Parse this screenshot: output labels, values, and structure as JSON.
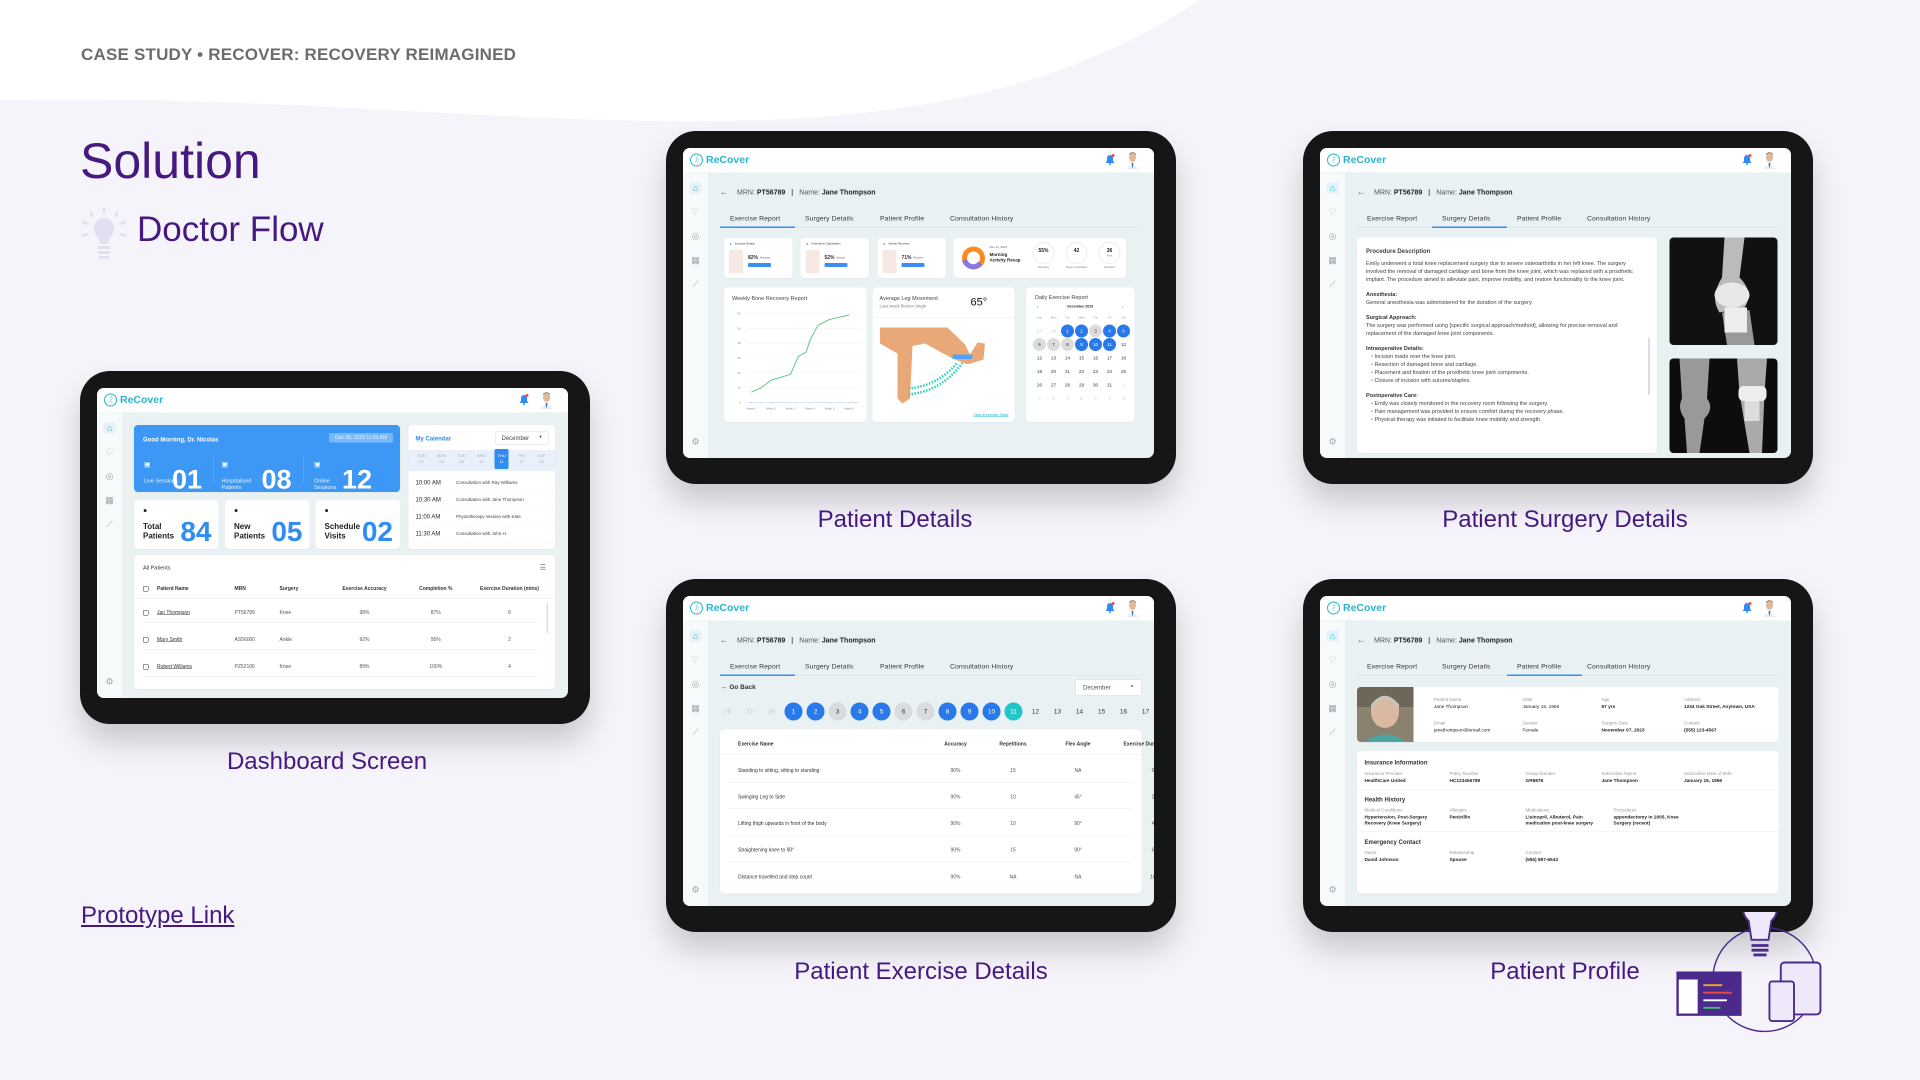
{
  "slide": {
    "eyebrow": "CASE STUDY • RECOVER: RECOVERY REIMAGINED",
    "title": "Solution",
    "subtitle": "Doctor Flow",
    "prototype_link": "Prototype Link",
    "title_color": "#45197f",
    "background": "#f5f4fa"
  },
  "captions": {
    "dashboard": "Dashboard Screen",
    "patient_details": "Patient Details",
    "surgery": "Patient Surgery Details",
    "exercise": "Patient Exercise Details",
    "profile": "Patient Profile"
  },
  "app": {
    "brand": "ReCover",
    "brand_color": "#2bb5c9",
    "primary": "#2f8cf0",
    "sidebar_icons": [
      "home-icon",
      "heart-icon",
      "target-icon",
      "calendar-icon",
      "chart-icon",
      "settings-icon"
    ]
  },
  "patient": {
    "mrn_label": "MRN:",
    "mrn": "PT56789",
    "name_label": "Name:",
    "name": "Jane Thompson",
    "tabs": [
      "Exercise Report",
      "Surgery Details",
      "Patient Profile",
      "Consultation History"
    ]
  },
  "dashboard": {
    "greeting": "Good Morning, Dr. Nicolas",
    "datetime": "Dec 08, 2023 11:00 AM",
    "sessions": [
      {
        "label": "Live Sessions",
        "value": "01"
      },
      {
        "label": "Hospitalised Patients",
        "value": "08"
      },
      {
        "label": "Online Sessions",
        "value": "12"
      }
    ],
    "cards": [
      {
        "label": "Total Patients",
        "value": "84"
      },
      {
        "label": "New Patients",
        "value": "05"
      },
      {
        "label": "Schedule Visits",
        "value": "02"
      }
    ],
    "calendar": {
      "title": "My Calendar",
      "month": "December",
      "days": [
        {
          "d": "SUN",
          "n": "07"
        },
        {
          "d": "MON",
          "n": "08"
        },
        {
          "d": "TUE",
          "n": "09"
        },
        {
          "d": "WED",
          "n": "10"
        },
        {
          "d": "THU",
          "n": "11",
          "active": true
        },
        {
          "d": "FRI",
          "n": "12"
        },
        {
          "d": "SAT",
          "n": "13"
        }
      ],
      "events": [
        {
          "time": "10:00 AM",
          "text": "Consultation with Ray Williams"
        },
        {
          "time": "10:30 AM",
          "text": "Consultation with Jane Thompson"
        },
        {
          "time": "11:00 AM",
          "text": "Physiotherapy session with Kate"
        },
        {
          "time": "11:30 AM",
          "text": "Consultation with John H."
        }
      ]
    },
    "patients": {
      "title": "All Patients",
      "columns": [
        "Patient Name",
        "MRN",
        "Surgery",
        "Exercise Accuracy",
        "Completion %",
        "Exercise Duration (mins)"
      ],
      "rows": [
        [
          "Jan Thompson",
          "PT56789",
          "Knee",
          "98%",
          "87%",
          "6"
        ],
        [
          "Mary Smith",
          "AS56000",
          "Ankle",
          "92%",
          "95%",
          "2"
        ],
        [
          "Robert Williams",
          "PZ52106",
          "Knee",
          "89%",
          "100%",
          "4"
        ]
      ]
    }
  },
  "patient_details": {
    "mini_cards": [
      {
        "title": "Exercise Details",
        "value": "82%",
        "unit": "Accuracy"
      },
      {
        "title": "Knee Bone Calcification",
        "value": "52%",
        "unit": "Normal"
      },
      {
        "title": "Muscle Recovery",
        "value": "71%",
        "unit": "Recover"
      }
    ],
    "recap": {
      "date": "Dec 11, 2023",
      "title": "Morning Activity Recap",
      "metrics": [
        {
          "value": "55%",
          "unit": "",
          "label": "Accuracy"
        },
        {
          "value": "42",
          "unit": "",
          "label": "Reps Completed"
        },
        {
          "value": "36",
          "unit": "mins",
          "label": "Duration"
        }
      ]
    },
    "bone_chart": {
      "title": "Weekly Bone Recovery Report",
      "y_ticks": [
        0,
        10,
        20,
        30,
        40,
        50,
        60
      ],
      "x_ticks": [
        "Week 1",
        "Week 2",
        "Week 3",
        "Week 4",
        "Week 5",
        "Week 6"
      ],
      "x": [
        1,
        1.5,
        2,
        2.5,
        3,
        3.4,
        3.8,
        4,
        4.4,
        5,
        6
      ],
      "y": [
        7,
        10,
        15,
        17,
        19,
        31,
        34,
        42,
        52,
        56,
        59
      ],
      "line_color": "#5fc98a"
    },
    "leg": {
      "title": "Average Leg Movement",
      "subtitle": "Last week flexion angle",
      "angle": "65°",
      "link": "View Exercise Stats"
    },
    "daily": {
      "title": "Daily Exercise Report",
      "month": "December 2023",
      "weekdays": [
        "Sun",
        "Mon",
        "Tue",
        "Wed",
        "Thu",
        "Fri",
        "Sat"
      ],
      "cells": [
        {
          "n": "27",
          "s": "faded"
        },
        {
          "n": "28",
          "s": "faded"
        },
        {
          "n": "1",
          "s": "done"
        },
        {
          "n": "2",
          "s": "done"
        },
        {
          "n": "3",
          "s": "missed"
        },
        {
          "n": "4",
          "s": "done"
        },
        {
          "n": "5",
          "s": "done"
        },
        {
          "n": "6",
          "s": "missed"
        },
        {
          "n": "7",
          "s": "missed"
        },
        {
          "n": "8",
          "s": "missed"
        },
        {
          "n": "9",
          "s": "done"
        },
        {
          "n": "10",
          "s": "done"
        },
        {
          "n": "11",
          "s": "done"
        },
        {
          "n": "12",
          "s": ""
        },
        {
          "n": "12",
          "s": ""
        },
        {
          "n": "13",
          "s": ""
        },
        {
          "n": "14",
          "s": ""
        },
        {
          "n": "15",
          "s": ""
        },
        {
          "n": "16",
          "s": ""
        },
        {
          "n": "17",
          "s": ""
        },
        {
          "n": "18",
          "s": ""
        },
        {
          "n": "19",
          "s": ""
        },
        {
          "n": "20",
          "s": ""
        },
        {
          "n": "21",
          "s": ""
        },
        {
          "n": "22",
          "s": ""
        },
        {
          "n": "23",
          "s": ""
        },
        {
          "n": "24",
          "s": ""
        },
        {
          "n": "25",
          "s": ""
        },
        {
          "n": "26",
          "s": ""
        },
        {
          "n": "27",
          "s": ""
        },
        {
          "n": "28",
          "s": ""
        },
        {
          "n": "29",
          "s": ""
        },
        {
          "n": "30",
          "s": ""
        },
        {
          "n": "31",
          "s": ""
        },
        {
          "n": "1",
          "s": "faded"
        },
        {
          "n": "2",
          "s": "faded"
        },
        {
          "n": "3",
          "s": "faded"
        },
        {
          "n": "4",
          "s": "faded"
        },
        {
          "n": "5",
          "s": "faded"
        },
        {
          "n": "6",
          "s": "faded"
        },
        {
          "n": "7",
          "s": "faded"
        },
        {
          "n": "8",
          "s": "faded"
        }
      ]
    }
  },
  "surgery": {
    "title": "Procedure Description",
    "intro": "Emily underwent a total knee replacement surgery due to severe osteoarthritis in her left knee. The surgery involved the removal of damaged cartilage and bone from the knee joint, which was replaced with a prosthetic implant. The procedure aimed to alleviate pain, improve mobility, and restore functionality to the knee joint.",
    "anesthesia_title": "Anesthesia:",
    "anesthesia": "General anesthesia was administered for the duration of the surgery.",
    "approach_title": "Surgical Approach:",
    "approach": "The surgery was performed using [specific surgical approach/method], allowing for precise removal and replacement of the damaged knee joint components.",
    "intraop_title": "Intraoperative Details:",
    "intraop": [
      "Incision made over the knee joint.",
      "Resection of damaged bone and cartilage.",
      "Placement and fixation of the prosthetic knee joint components.",
      "Closure of incision with sutures/staples."
    ],
    "postop_title": "Postoperative Care:",
    "postop": [
      "Emily was closely monitored in the recovery room following the surgery.",
      "Pain management was provided to ensure comfort during the recovery phase.",
      "Physical therapy was initiated to facilitate knee mobility and strength."
    ]
  },
  "exercise": {
    "back": "Go Back",
    "month": "December",
    "days": [
      {
        "n": "26",
        "s": "faded"
      },
      {
        "n": "27",
        "s": "faded"
      },
      {
        "n": "28",
        "s": "faded"
      },
      {
        "n": "1",
        "s": "done"
      },
      {
        "n": "2",
        "s": "done"
      },
      {
        "n": "3",
        "s": "missed"
      },
      {
        "n": "4",
        "s": "done"
      },
      {
        "n": "5",
        "s": "done"
      },
      {
        "n": "6",
        "s": "missed"
      },
      {
        "n": "7",
        "s": "missed"
      },
      {
        "n": "8",
        "s": "done"
      },
      {
        "n": "9",
        "s": "done"
      },
      {
        "n": "10",
        "s": "done"
      },
      {
        "n": "11",
        "s": "today"
      },
      {
        "n": "12",
        "s": ""
      },
      {
        "n": "13",
        "s": ""
      },
      {
        "n": "14",
        "s": ""
      },
      {
        "n": "15",
        "s": ""
      },
      {
        "n": "16",
        "s": ""
      },
      {
        "n": "17",
        "s": ""
      }
    ],
    "columns": [
      "Exercise Name",
      "Accuracy",
      "Repetitions",
      "Flex Angle",
      "Exercise Duration (mins)"
    ],
    "rows": [
      [
        "Standing to sitting, sitting to standing",
        "90%",
        "15",
        "NA",
        "6"
      ],
      [
        "Swinging Leg to Side",
        "90%",
        "10",
        "45°",
        "2"
      ],
      [
        "Lifting thigh upwards in front of the body",
        "90%",
        "10",
        "90°",
        "4"
      ],
      [
        "Straightening knee to 90°",
        "90%",
        "15",
        "90°",
        "6"
      ],
      [
        "Distance travelled and step count",
        "90%",
        "NA",
        "NA",
        "10"
      ]
    ]
  },
  "profile": {
    "fields": [
      {
        "label": "Patient Name",
        "value": "Jane Thompson"
      },
      {
        "label": "DOB",
        "value": "January 15, 1956"
      },
      {
        "label": "Age",
        "value": "67 yrs"
      },
      {
        "label": "Address",
        "value": "1234 Oak Street, Anytown, USA"
      },
      {
        "label": "Email",
        "value": "janethompson@email.com"
      },
      {
        "label": "Gender",
        "value": "Female"
      },
      {
        "label": "Surgery Date",
        "value": "November 07, 2023"
      },
      {
        "label": "Contact",
        "value": "(555) 123-4567"
      }
    ],
    "insurance_title": "Insurance Information",
    "insurance": [
      {
        "label": "Insurance Provider",
        "value": "HealthCare United"
      },
      {
        "label": "Policy Number",
        "value": "HC123456789"
      },
      {
        "label": "Group Number",
        "value": "GR9876"
      },
      {
        "label": "Subscriber Name",
        "value": "Jane Thompson"
      },
      {
        "label": "Subscriber Date of Birth",
        "value": "January 15, 1956"
      }
    ],
    "history_title": "Health History",
    "history": [
      {
        "label": "Medical Conditions",
        "value": "Hypertension, Post-Surgery Recovery (Knee Surgery)"
      },
      {
        "label": "Allergies",
        "value": "Penicillin"
      },
      {
        "label": "Medications",
        "value": "Lisinopril, Albuterol, Pain medication post-knee surgery"
      },
      {
        "label": "Procedures",
        "value": "appendectomy in 2005, Knee Surgery (recent)"
      }
    ],
    "emergency_title": "Emergency Contact",
    "emergency": [
      {
        "label": "Name",
        "value": "David Johnson"
      },
      {
        "label": "Relationship",
        "value": "Spouse"
      },
      {
        "label": "Contact",
        "value": "(555) 987-6543"
      }
    ]
  }
}
